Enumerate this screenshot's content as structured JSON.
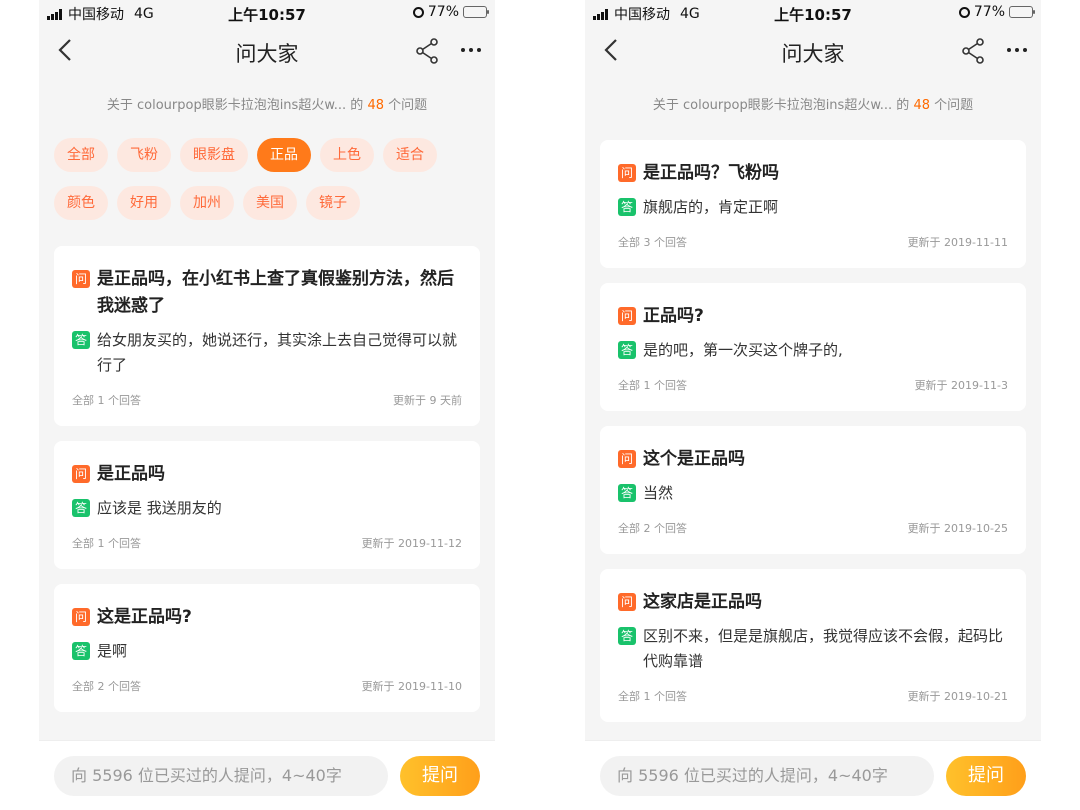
{
  "status": {
    "carrier": "中国移动",
    "network": "4G",
    "time": "上午10:57",
    "battery": "77%",
    "battery_level": 0.77
  },
  "nav": {
    "title": "问大家"
  },
  "subtitle": {
    "prefix": "关于 colourpop眼影卡拉泡泡ins超火w... 的",
    "count": "48",
    "suffix": "个问题"
  },
  "badges": {
    "question": "问",
    "answer": "答"
  },
  "tags": [
    {
      "label": "全部",
      "active": false
    },
    {
      "label": "飞粉",
      "active": false
    },
    {
      "label": "眼影盘",
      "active": false
    },
    {
      "label": "正品",
      "active": true
    },
    {
      "label": "上色",
      "active": false
    },
    {
      "label": "适合",
      "active": false
    },
    {
      "label": "颜色",
      "active": false
    },
    {
      "label": "好用",
      "active": false
    },
    {
      "label": "加州",
      "active": false
    },
    {
      "label": "美国",
      "active": false
    },
    {
      "label": "镜子",
      "active": false
    }
  ],
  "left_questions": [
    {
      "question": "是正品吗，在小红书上查了真假鉴别方法，然后我迷惑了",
      "answer": "给女朋友买的，她说还行，其实涂上去自己觉得可以就行了",
      "count_text": "全部 1 个回答",
      "updated": "更新于 9 天前"
    },
    {
      "question": "是正品吗",
      "answer": "应该是 我送朋友的",
      "count_text": "全部 1 个回答",
      "updated": "更新于 2019-11-12"
    },
    {
      "question": "这是正品吗?",
      "answer": "是啊",
      "count_text": "全部 2 个回答",
      "updated": "更新于 2019-11-10"
    }
  ],
  "right_questions": [
    {
      "question": "是正品吗？飞粉吗",
      "answer": "旗舰店的，肯定正啊",
      "count_text": "全部 3 个回答",
      "updated": "更新于 2019-11-11"
    },
    {
      "question": "正品吗?",
      "answer": "是的吧，第一次买这个牌子的,",
      "count_text": "全部 1 个回答",
      "updated": "更新于 2019-11-3"
    },
    {
      "question": "这个是正品吗",
      "answer": "当然",
      "count_text": "全部 2 个回答",
      "updated": "更新于 2019-10-25"
    },
    {
      "question": "这家店是正品吗",
      "answer": "区别不来，但是是旗舰店，我觉得应该不会假，起码比代购靠谱",
      "count_text": "全部 1 个回答",
      "updated": "更新于 2019-10-21"
    }
  ],
  "bottom": {
    "placeholder": "向 5596 位已买过的人提问，4~40字",
    "ask_label": "提问"
  }
}
